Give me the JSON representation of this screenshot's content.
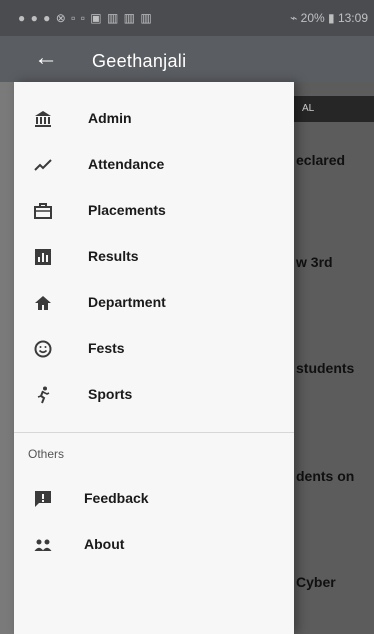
{
  "status_bar": {
    "left": "● ● ● ⊗ ▫ ▫ ▣  ▥ ▥ ▥",
    "right": "⌁ 20% ▮ 13:09"
  },
  "header": {
    "title": "Geethanjali"
  },
  "drawer": {
    "items": [
      {
        "label": "Admin",
        "icon": "bank-icon"
      },
      {
        "label": "Attendance",
        "icon": "trend-icon"
      },
      {
        "label": "Placements",
        "icon": "briefcase-icon"
      },
      {
        "label": "Results",
        "icon": "chart-icon"
      },
      {
        "label": "Department",
        "icon": "home-icon"
      },
      {
        "label": "Fests",
        "icon": "smile-icon"
      },
      {
        "label": "Sports",
        "icon": "run-icon"
      }
    ],
    "section_label": "Others",
    "others": [
      {
        "label": "Feedback",
        "icon": "feedback-icon"
      },
      {
        "label": "About",
        "icon": "people-icon"
      }
    ]
  },
  "background": {
    "strip_text": "AL",
    "texts": [
      "eclared",
      "w 3rd",
      "students",
      "dents on",
      "Cyber"
    ]
  }
}
